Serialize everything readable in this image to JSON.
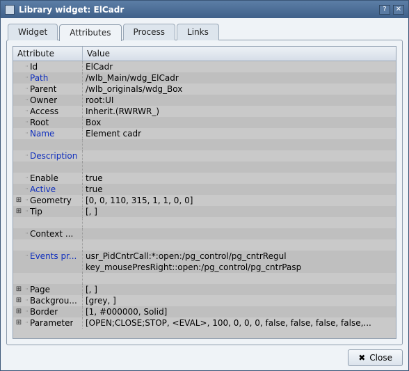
{
  "window": {
    "title": "Library widget: ElCadr"
  },
  "tabs": {
    "widget": "Widget",
    "attributes": "Attributes",
    "process": "Process",
    "links": "Links"
  },
  "table": {
    "header_attr": "Attribute",
    "header_val": "Value"
  },
  "rows": [
    {
      "exp": "",
      "name": "Id",
      "link": false,
      "value": "ElCadr"
    },
    {
      "exp": "",
      "name": "Path",
      "link": true,
      "value": "/wlb_Main/wdg_ElCadr"
    },
    {
      "exp": "",
      "name": "Parent",
      "link": false,
      "value": "/wlb_originals/wdg_Box"
    },
    {
      "exp": "",
      "name": "Owner",
      "link": false,
      "value": "root:UI"
    },
    {
      "exp": "",
      "name": "Access",
      "link": false,
      "value": "Inherit.(RWRWR_)"
    },
    {
      "exp": "",
      "name": "Root",
      "link": false,
      "value": "Box"
    },
    {
      "exp": "",
      "name": "Name",
      "link": true,
      "value": "Element cadr"
    },
    {
      "exp": "spacer"
    },
    {
      "exp": "",
      "name": "Description",
      "link": true,
      "value": ""
    },
    {
      "exp": "spacer"
    },
    {
      "exp": "",
      "name": "Enable",
      "link": false,
      "value": "true"
    },
    {
      "exp": "",
      "name": "Active",
      "link": true,
      "value": "true"
    },
    {
      "exp": "+",
      "name": "Geometry",
      "link": false,
      "value": "[0, 0, 110, 315, 1, 1, 0, 0]"
    },
    {
      "exp": "+",
      "name": "Tip",
      "link": false,
      "value": "[, ]"
    },
    {
      "exp": "spacer"
    },
    {
      "exp": "",
      "name": "Context ...",
      "link": false,
      "value": ""
    },
    {
      "exp": "spacer"
    },
    {
      "exp": "",
      "name": "Events pr...",
      "link": true,
      "value": "usr_PidCntrCall:*:open:/pg_control/pg_cntrRegul\nkey_mousePresRight::open:/pg_control/pg_cntrPasp"
    },
    {
      "exp": "spacer"
    },
    {
      "exp": "+",
      "name": "Page",
      "link": false,
      "value": "[, ]"
    },
    {
      "exp": "+",
      "name": "Backgrou...",
      "link": false,
      "value": "[grey, ]"
    },
    {
      "exp": "+",
      "name": "Border",
      "link": false,
      "value": "[1, #000000, Solid]"
    },
    {
      "exp": "+",
      "name": "Parameter",
      "link": false,
      "value": "[OPEN;CLOSE;STOP, <EVAL>, 100, 0, 0, 0, false, false, false, false,..."
    }
  ],
  "footer": {
    "close": "Close"
  }
}
